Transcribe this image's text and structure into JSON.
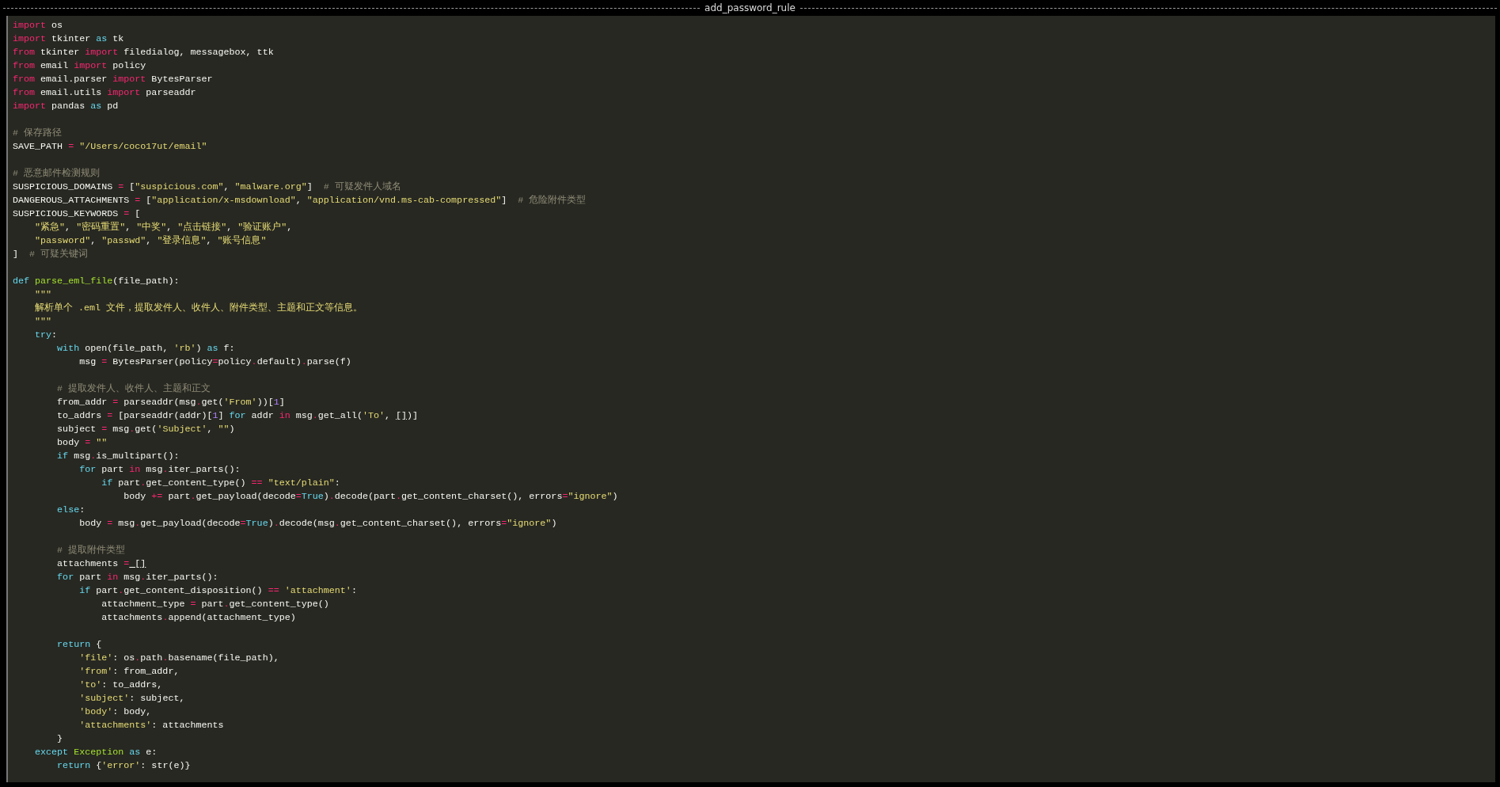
{
  "window": {
    "title": "add_password_rule"
  },
  "editor": {
    "lines": [
      {
        "kind": "code",
        "tokens": [
          {
            "text": "import",
            "kind": "keyword"
          },
          {
            "text": " os",
            "kind": "plain"
          }
        ]
      },
      {
        "kind": "code",
        "tokens": [
          {
            "text": "import",
            "kind": "keyword"
          },
          {
            "text": " tkinter ",
            "kind": "plain"
          },
          {
            "text": "as",
            "kind": "flow"
          },
          {
            "text": " tk",
            "kind": "plain"
          }
        ]
      },
      {
        "kind": "code",
        "tokens": [
          {
            "text": "from",
            "kind": "keyword"
          },
          {
            "text": " tkinter ",
            "kind": "plain"
          },
          {
            "text": "import",
            "kind": "keyword"
          },
          {
            "text": " filedialog, messagebox, ttk",
            "kind": "plain"
          }
        ]
      },
      {
        "kind": "code",
        "tokens": [
          {
            "text": "from",
            "kind": "keyword"
          },
          {
            "text": " email ",
            "kind": "plain"
          },
          {
            "text": "import",
            "kind": "keyword"
          },
          {
            "text": " policy",
            "kind": "plain"
          }
        ]
      },
      {
        "kind": "code",
        "tokens": [
          {
            "text": "from",
            "kind": "keyword"
          },
          {
            "text": " email.parser ",
            "kind": "plain"
          },
          {
            "text": "import",
            "kind": "keyword"
          },
          {
            "text": " BytesParser",
            "kind": "plain"
          }
        ]
      },
      {
        "kind": "code",
        "tokens": [
          {
            "text": "from",
            "kind": "keyword"
          },
          {
            "text": " email.utils ",
            "kind": "plain"
          },
          {
            "text": "import",
            "kind": "keyword"
          },
          {
            "text": " parseaddr",
            "kind": "plain"
          }
        ]
      },
      {
        "kind": "code",
        "tokens": [
          {
            "text": "import",
            "kind": "keyword"
          },
          {
            "text": " pandas ",
            "kind": "plain"
          },
          {
            "text": "as",
            "kind": "flow"
          },
          {
            "text": " pd",
            "kind": "plain"
          }
        ]
      },
      {
        "kind": "blank"
      },
      {
        "kind": "code",
        "tokens": [
          {
            "text": "# 保存路径",
            "kind": "comment"
          }
        ]
      },
      {
        "kind": "code",
        "tokens": [
          {
            "text": "SAVE_PATH ",
            "kind": "plain"
          },
          {
            "text": "=",
            "kind": "operator"
          },
          {
            "text": " \"/Users/coco17ut/email\"",
            "kind": "string"
          }
        ]
      },
      {
        "kind": "blank"
      },
      {
        "kind": "code",
        "tokens": [
          {
            "text": "# 恶意邮件检测规则",
            "kind": "comment"
          }
        ]
      },
      {
        "kind": "code",
        "tokens": [
          {
            "text": "SUSPICIOUS_DOMAINS ",
            "kind": "plain"
          },
          {
            "text": "=",
            "kind": "operator"
          },
          {
            "text": " [",
            "kind": "plain"
          },
          {
            "text": "\"suspicious.com\"",
            "kind": "string"
          },
          {
            "text": ", ",
            "kind": "plain"
          },
          {
            "text": "\"malware.org\"",
            "kind": "string"
          },
          {
            "text": "]  ",
            "kind": "plain"
          },
          {
            "text": "# 可疑发件人域名",
            "kind": "comment"
          }
        ]
      },
      {
        "kind": "code",
        "tokens": [
          {
            "text": "DANGEROUS_ATTACHMENTS ",
            "kind": "plain"
          },
          {
            "text": "=",
            "kind": "operator"
          },
          {
            "text": " [",
            "kind": "plain"
          },
          {
            "text": "\"application/x-msdownload\"",
            "kind": "string"
          },
          {
            "text": ", ",
            "kind": "plain"
          },
          {
            "text": "\"application/vnd.ms-cab-compressed\"",
            "kind": "string"
          },
          {
            "text": "]  ",
            "kind": "plain"
          },
          {
            "text": "# 危险附件类型",
            "kind": "comment"
          }
        ]
      },
      {
        "kind": "code",
        "tokens": [
          {
            "text": "SUSPICIOUS_KEYWORDS ",
            "kind": "plain"
          },
          {
            "text": "=",
            "kind": "operator"
          },
          {
            "text": " [",
            "kind": "plain"
          }
        ]
      },
      {
        "kind": "code",
        "tokens": [
          {
            "text": "    \"紧急\"",
            "kind": "string"
          },
          {
            "text": ", ",
            "kind": "plain"
          },
          {
            "text": "\"密码重置\"",
            "kind": "string"
          },
          {
            "text": ", ",
            "kind": "plain"
          },
          {
            "text": "\"中奖\"",
            "kind": "string"
          },
          {
            "text": ", ",
            "kind": "plain"
          },
          {
            "text": "\"点击链接\"",
            "kind": "string"
          },
          {
            "text": ", ",
            "kind": "plain"
          },
          {
            "text": "\"验证账户\"",
            "kind": "string"
          },
          {
            "text": ",",
            "kind": "plain"
          }
        ]
      },
      {
        "kind": "code",
        "tokens": [
          {
            "text": "    \"password\"",
            "kind": "string"
          },
          {
            "text": ", ",
            "kind": "plain"
          },
          {
            "text": "\"passwd\"",
            "kind": "string"
          },
          {
            "text": ", ",
            "kind": "plain"
          },
          {
            "text": "\"登录信息\"",
            "kind": "string"
          },
          {
            "text": ", ",
            "kind": "plain"
          },
          {
            "text": "\"账号信息\"",
            "kind": "string"
          }
        ]
      },
      {
        "kind": "code",
        "tokens": [
          {
            "text": "]  ",
            "kind": "plain"
          },
          {
            "text": "# 可疑关键词",
            "kind": "comment"
          }
        ]
      },
      {
        "kind": "blank"
      },
      {
        "kind": "code",
        "tokens": [
          {
            "text": "def",
            "kind": "flow"
          },
          {
            "text": " parse_eml_file",
            "kind": "function"
          },
          {
            "text": "(file_path):",
            "kind": "plain"
          }
        ]
      },
      {
        "kind": "code",
        "tokens": [
          {
            "text": "    \"\"\"",
            "kind": "string"
          }
        ]
      },
      {
        "kind": "code",
        "tokens": [
          {
            "text": "    解析单个 .eml 文件，提取发件人、收件人、附件类型、主题和正文等信息。",
            "kind": "string"
          }
        ]
      },
      {
        "kind": "code",
        "tokens": [
          {
            "text": "    \"\"\"",
            "kind": "string"
          }
        ]
      },
      {
        "kind": "code",
        "tokens": [
          {
            "text": "    try",
            "kind": "flow"
          },
          {
            "text": ":",
            "kind": "plain"
          }
        ]
      },
      {
        "kind": "code",
        "tokens": [
          {
            "text": "        with",
            "kind": "flow"
          },
          {
            "text": " open(file_path, ",
            "kind": "plain"
          },
          {
            "text": "'rb'",
            "kind": "string"
          },
          {
            "text": ") ",
            "kind": "plain"
          },
          {
            "text": "as",
            "kind": "flow"
          },
          {
            "text": " f:",
            "kind": "plain"
          }
        ]
      },
      {
        "kind": "code",
        "tokens": [
          {
            "text": "            msg ",
            "kind": "plain"
          },
          {
            "text": "=",
            "kind": "operator"
          },
          {
            "text": " BytesParser(policy",
            "kind": "plain"
          },
          {
            "text": "=",
            "kind": "operator"
          },
          {
            "text": "policy",
            "kind": "plain"
          },
          {
            "text": ".",
            "kind": "operator"
          },
          {
            "text": "default)",
            "kind": "plain"
          },
          {
            "text": ".",
            "kind": "operator"
          },
          {
            "text": "parse(f)",
            "kind": "plain"
          }
        ]
      },
      {
        "kind": "blank"
      },
      {
        "kind": "code",
        "tokens": [
          {
            "text": "        # 提取发件人、收件人、主题和正文",
            "kind": "comment"
          }
        ]
      },
      {
        "kind": "code",
        "tokens": [
          {
            "text": "        from_addr ",
            "kind": "plain"
          },
          {
            "text": "=",
            "kind": "operator"
          },
          {
            "text": " parseaddr(msg",
            "kind": "plain"
          },
          {
            "text": ".",
            "kind": "operator"
          },
          {
            "text": "get(",
            "kind": "plain"
          },
          {
            "text": "'From'",
            "kind": "string"
          },
          {
            "text": "))[",
            "kind": "plain"
          },
          {
            "text": "1",
            "kind": "number"
          },
          {
            "text": "]",
            "kind": "plain"
          }
        ]
      },
      {
        "kind": "code",
        "tokens": [
          {
            "text": "        to_addrs ",
            "kind": "plain"
          },
          {
            "text": "=",
            "kind": "operator"
          },
          {
            "text": " [parseaddr(addr)[",
            "kind": "plain"
          },
          {
            "text": "1",
            "kind": "number"
          },
          {
            "text": "] ",
            "kind": "plain"
          },
          {
            "text": "for",
            "kind": "flow"
          },
          {
            "text": " addr ",
            "kind": "plain"
          },
          {
            "text": "in",
            "kind": "keyword"
          },
          {
            "text": " msg",
            "kind": "plain"
          },
          {
            "text": ".",
            "kind": "operator"
          },
          {
            "text": "get_all(",
            "kind": "plain"
          },
          {
            "text": "'To'",
            "kind": "string"
          },
          {
            "text": ", ",
            "kind": "plain"
          },
          {
            "text": "[]",
            "kind": "match"
          },
          {
            "text": ")]",
            "kind": "plain"
          }
        ]
      },
      {
        "kind": "code",
        "tokens": [
          {
            "text": "        subject ",
            "kind": "plain"
          },
          {
            "text": "=",
            "kind": "operator"
          },
          {
            "text": " msg",
            "kind": "plain"
          },
          {
            "text": ".",
            "kind": "operator"
          },
          {
            "text": "get(",
            "kind": "plain"
          },
          {
            "text": "'Subject'",
            "kind": "string"
          },
          {
            "text": ", ",
            "kind": "plain"
          },
          {
            "text": "\"\"",
            "kind": "string"
          },
          {
            "text": ")",
            "kind": "plain"
          }
        ]
      },
      {
        "kind": "code",
        "tokens": [
          {
            "text": "        body ",
            "kind": "plain"
          },
          {
            "text": "=",
            "kind": "operator"
          },
          {
            "text": " \"\"",
            "kind": "string"
          }
        ]
      },
      {
        "kind": "code",
        "tokens": [
          {
            "text": "        if",
            "kind": "flow"
          },
          {
            "text": " msg",
            "kind": "plain"
          },
          {
            "text": ".",
            "kind": "operator"
          },
          {
            "text": "is_multipart():",
            "kind": "plain"
          }
        ]
      },
      {
        "kind": "code",
        "tokens": [
          {
            "text": "            for",
            "kind": "flow"
          },
          {
            "text": " part ",
            "kind": "plain"
          },
          {
            "text": "in",
            "kind": "keyword"
          },
          {
            "text": " msg",
            "kind": "plain"
          },
          {
            "text": ".",
            "kind": "operator"
          },
          {
            "text": "iter_parts():",
            "kind": "plain"
          }
        ]
      },
      {
        "kind": "code",
        "tokens": [
          {
            "text": "                if",
            "kind": "flow"
          },
          {
            "text": " part",
            "kind": "plain"
          },
          {
            "text": ".",
            "kind": "operator"
          },
          {
            "text": "get_content_type() ",
            "kind": "plain"
          },
          {
            "text": "==",
            "kind": "operator"
          },
          {
            "text": " \"text/plain\"",
            "kind": "string"
          },
          {
            "text": ":",
            "kind": "plain"
          }
        ]
      },
      {
        "kind": "code",
        "tokens": [
          {
            "text": "                    body ",
            "kind": "plain"
          },
          {
            "text": "+=",
            "kind": "operator"
          },
          {
            "text": " part",
            "kind": "plain"
          },
          {
            "text": ".",
            "kind": "operator"
          },
          {
            "text": "get_payload(decode",
            "kind": "plain"
          },
          {
            "text": "=",
            "kind": "operator"
          },
          {
            "text": "True",
            "kind": "flow"
          },
          {
            "text": ")",
            "kind": "plain"
          },
          {
            "text": ".",
            "kind": "operator"
          },
          {
            "text": "decode(part",
            "kind": "plain"
          },
          {
            "text": ".",
            "kind": "operator"
          },
          {
            "text": "get_content_charset(), errors",
            "kind": "plain"
          },
          {
            "text": "=",
            "kind": "operator"
          },
          {
            "text": "\"ignore\"",
            "kind": "string"
          },
          {
            "text": ")",
            "kind": "plain"
          }
        ]
      },
      {
        "kind": "code",
        "tokens": [
          {
            "text": "        else",
            "kind": "flow"
          },
          {
            "text": ":",
            "kind": "plain"
          }
        ]
      },
      {
        "kind": "code",
        "tokens": [
          {
            "text": "            body ",
            "kind": "plain"
          },
          {
            "text": "=",
            "kind": "operator"
          },
          {
            "text": " msg",
            "kind": "plain"
          },
          {
            "text": ".",
            "kind": "operator"
          },
          {
            "text": "get_payload(decode",
            "kind": "plain"
          },
          {
            "text": "=",
            "kind": "operator"
          },
          {
            "text": "True",
            "kind": "flow"
          },
          {
            "text": ")",
            "kind": "plain"
          },
          {
            "text": ".",
            "kind": "operator"
          },
          {
            "text": "decode(msg",
            "kind": "plain"
          },
          {
            "text": ".",
            "kind": "operator"
          },
          {
            "text": "get_content_charset(), errors",
            "kind": "plain"
          },
          {
            "text": "=",
            "kind": "operator"
          },
          {
            "text": "\"ignore\"",
            "kind": "string"
          },
          {
            "text": ")",
            "kind": "plain"
          }
        ]
      },
      {
        "kind": "blank"
      },
      {
        "kind": "code",
        "tokens": [
          {
            "text": "        # 提取附件类型",
            "kind": "comment"
          }
        ]
      },
      {
        "kind": "code",
        "tokens": [
          {
            "text": "        attachments ",
            "kind": "plain"
          },
          {
            "text": "=",
            "kind": "operator"
          },
          {
            "text": " []",
            "kind": "match"
          }
        ]
      },
      {
        "kind": "code",
        "tokens": [
          {
            "text": "        for",
            "kind": "flow"
          },
          {
            "text": " part ",
            "kind": "plain"
          },
          {
            "text": "in",
            "kind": "keyword"
          },
          {
            "text": " msg",
            "kind": "plain"
          },
          {
            "text": ".",
            "kind": "operator"
          },
          {
            "text": "iter_parts():",
            "kind": "plain"
          }
        ]
      },
      {
        "kind": "code",
        "tokens": [
          {
            "text": "            if",
            "kind": "flow"
          },
          {
            "text": " part",
            "kind": "plain"
          },
          {
            "text": ".",
            "kind": "operator"
          },
          {
            "text": "get_content_disposition() ",
            "kind": "plain"
          },
          {
            "text": "==",
            "kind": "operator"
          },
          {
            "text": " 'attachment'",
            "kind": "string"
          },
          {
            "text": ":",
            "kind": "plain"
          }
        ]
      },
      {
        "kind": "code",
        "tokens": [
          {
            "text": "                attachment_type ",
            "kind": "plain"
          },
          {
            "text": "=",
            "kind": "operator"
          },
          {
            "text": " part",
            "kind": "plain"
          },
          {
            "text": ".",
            "kind": "operator"
          },
          {
            "text": "get_content_type()",
            "kind": "plain"
          }
        ]
      },
      {
        "kind": "code",
        "tokens": [
          {
            "text": "                attachments",
            "kind": "plain"
          },
          {
            "text": ".",
            "kind": "operator"
          },
          {
            "text": "append(attachment_type)",
            "kind": "plain"
          }
        ]
      },
      {
        "kind": "blank"
      },
      {
        "kind": "code",
        "tokens": [
          {
            "text": "        return",
            "kind": "flow"
          },
          {
            "text": " {",
            "kind": "plain"
          }
        ]
      },
      {
        "kind": "code",
        "tokens": [
          {
            "text": "            'file'",
            "kind": "string"
          },
          {
            "text": ": os",
            "kind": "plain"
          },
          {
            "text": ".",
            "kind": "operator"
          },
          {
            "text": "path",
            "kind": "plain"
          },
          {
            "text": ".",
            "kind": "operator"
          },
          {
            "text": "basename(file_path),",
            "kind": "plain"
          }
        ]
      },
      {
        "kind": "code",
        "tokens": [
          {
            "text": "            'from'",
            "kind": "string"
          },
          {
            "text": ": from_addr,",
            "kind": "plain"
          }
        ]
      },
      {
        "kind": "code",
        "tokens": [
          {
            "text": "            'to'",
            "kind": "string"
          },
          {
            "text": ": to_addrs,",
            "kind": "plain"
          }
        ]
      },
      {
        "kind": "code",
        "tokens": [
          {
            "text": "            'subject'",
            "kind": "string"
          },
          {
            "text": ": subject,",
            "kind": "plain"
          }
        ]
      },
      {
        "kind": "code",
        "tokens": [
          {
            "text": "            'body'",
            "kind": "string"
          },
          {
            "text": ": body,",
            "kind": "plain"
          }
        ]
      },
      {
        "kind": "code",
        "tokens": [
          {
            "text": "            'attachments'",
            "kind": "string"
          },
          {
            "text": ": attachments",
            "kind": "plain"
          }
        ]
      },
      {
        "kind": "code",
        "tokens": [
          {
            "text": "        }",
            "kind": "plain"
          }
        ]
      },
      {
        "kind": "code",
        "tokens": [
          {
            "text": "    except",
            "kind": "flow"
          },
          {
            "text": " Exception",
            "kind": "function"
          },
          {
            "text": " as",
            "kind": "flow"
          },
          {
            "text": " e:",
            "kind": "plain"
          }
        ]
      },
      {
        "kind": "code",
        "tokens": [
          {
            "text": "        return",
            "kind": "flow"
          },
          {
            "text": " {",
            "kind": "plain"
          },
          {
            "text": "'error'",
            "kind": "string"
          },
          {
            "text": ": str(e)}",
            "kind": "plain"
          }
        ]
      }
    ]
  }
}
